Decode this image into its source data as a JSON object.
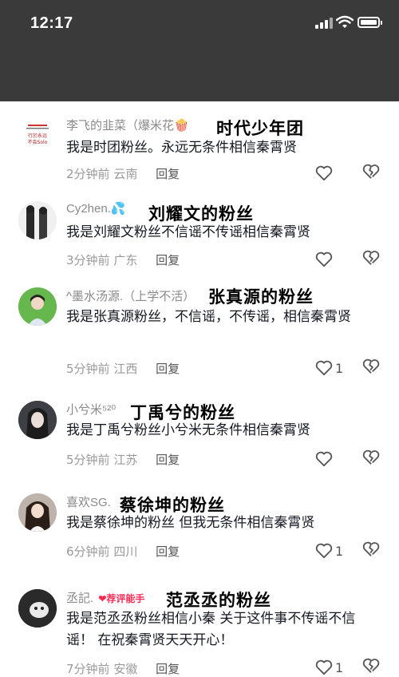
{
  "status_bar": {
    "time": "12:17"
  },
  "comments": [
    {
      "username": "李飞的韭菜（爆米花🍿",
      "tagline": "时代少年团",
      "text": "我是时团粉丝。永远无条件相信秦霄贤",
      "time": "2分钟前",
      "location": "云南",
      "reply_label": "回复",
      "likes": ""
    },
    {
      "username": "Cy2hen.💦",
      "tagline": "刘耀文的粉丝",
      "text": "我是刘耀文粉丝不信谣不传谣相信秦霄贤",
      "time": "3分钟前",
      "location": "广东",
      "reply_label": "回复",
      "likes": ""
    },
    {
      "username": "^墨水汤源.（上学不活）",
      "tagline": "张真源的粉丝",
      "text": "我是张真源粉丝，不信谣，不传谣，相信秦霄贤",
      "time": "5分钟前",
      "location": "江西",
      "reply_label": "回复",
      "likes": "1"
    },
    {
      "username": "小兮米⁵²⁰",
      "tagline": "丁禹兮的粉丝",
      "text": "我是丁禹兮粉丝小兮米无条件相信秦霄贤",
      "time": "5分钟前",
      "location": "江苏",
      "reply_label": "回复",
      "likes": ""
    },
    {
      "username": "喜欢SG.",
      "tagline": "蔡徐坤的粉丝",
      "text": "我是蔡徐坤的粉丝 但我无条件相信秦霄贤",
      "time": "6分钟前",
      "location": "四川",
      "reply_label": "回复",
      "likes": "1"
    },
    {
      "username": "丞記.",
      "badge": "❤荐评能手",
      "tagline": "范丞丞的粉丝",
      "text": "我是范丞丞粉丝相信小秦 关于这件事不传谣不信谣！ 在祝秦霄贤天天开心！",
      "time": "7分钟前",
      "location": "安徽",
      "reply_label": "回复",
      "likes": "1"
    }
  ],
  "avatar_text": {
    "line1": "行於永远",
    "line2": "不会Solo"
  },
  "colors": {
    "status_bar_bg": "#3a3a3a",
    "icon_gray": "#555555",
    "meta_gray": "#9a9a9a"
  }
}
